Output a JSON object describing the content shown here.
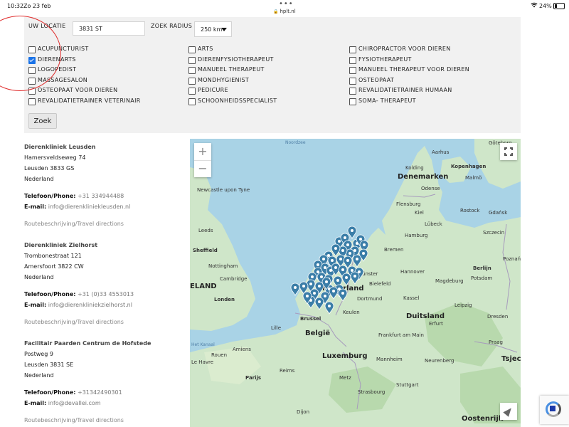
{
  "statusbar": {
    "time": "10:32",
    "date": "Zo 23 feb",
    "url": "hplt.nl",
    "battery": "24%",
    "wifi_icon": "wifi-icon",
    "lock_icon": "lock-icon"
  },
  "filters": {
    "location_label": "UW LOCATIE",
    "location_value": "3831 ST",
    "radius_label": "ZOEK RADIUS",
    "radius_value": "250 km",
    "search_button": "Zoek",
    "categories": [
      {
        "label": "ACUPUNCTURIST",
        "checked": false
      },
      {
        "label": "ARTS",
        "checked": false
      },
      {
        "label": "CHIROPRACTOR VOOR DIEREN",
        "checked": false
      },
      {
        "label": "DIERENARTS",
        "checked": true
      },
      {
        "label": "DIERENFYSIOTHERAPEUT",
        "checked": false
      },
      {
        "label": "FYSIOTHERAPEUT",
        "checked": false
      },
      {
        "label": "LOGOPEDIST",
        "checked": false
      },
      {
        "label": "MANUEEL THERAPEUT",
        "checked": false
      },
      {
        "label": "MANUEEL THERAPEUT VOOR DIEREN",
        "checked": false
      },
      {
        "label": "MASSAGESALON",
        "checked": false
      },
      {
        "label": "MONDHYGIENIST",
        "checked": false
      },
      {
        "label": "OSTEOPAAT",
        "checked": false
      },
      {
        "label": "OSTEOPAAT VOOR DIEREN",
        "checked": false
      },
      {
        "label": "PEDICURE",
        "checked": false
      },
      {
        "label": "REVALIDATIETRAINER HUMAAN",
        "checked": false
      },
      {
        "label": "REVALIDATIETRAINER VETERINAIR",
        "checked": false
      },
      {
        "label": "SCHOONHEIDSSPECIALIST",
        "checked": false
      },
      {
        "label": "SOMA- THERAPEUT",
        "checked": false
      }
    ]
  },
  "results": [
    {
      "name": "Dierenkliniek Leusden",
      "street": "Hamersveldseweg 74",
      "city": "Leusden 3833 GS",
      "country": "Nederland",
      "phone_label": "Telefoon/Phone:",
      "phone": "+31 334944488",
      "email_label": "E-mail:",
      "email": "info@dierenkliniekleusden.nl",
      "route": "Routebeschrijving/Travel directions"
    },
    {
      "name": "Dierenkliniek Zielhorst",
      "street": "Trombonestraat 121",
      "city": "Amersfoort 3822 CW",
      "country": "Nederland",
      "phone_label": "Telefoon/Phone:",
      "phone": "+31 (0)33 4553013",
      "email_label": "E-mail:",
      "email": "info@dierenkliniekzielhorst.nl",
      "route": "Routebeschrijving/Travel directions"
    },
    {
      "name": "Facilitair Paarden Centrum de Hofstede",
      "street": "Postweg 9",
      "city": "Leusden 3831 SE",
      "country": "Nederland",
      "phone_label": "Telefoon/Phone:",
      "phone": "+31342490301",
      "email_label": "E-mail:",
      "email": "info@devallei.com",
      "route": "Routebeschrijving/Travel directions"
    }
  ],
  "map": {
    "zoom_in": "+",
    "zoom_out": "−",
    "labels": {
      "noordzee": "Noordzee",
      "denemarken": "Denemarken",
      "kopenhagen": "Kopenhagen",
      "malmo": "Malmö",
      "flensburg": "Flensburg",
      "kiel": "Kiel",
      "lubeck": "Lübeck",
      "hamburg": "Hamburg",
      "bremen": "Bremen",
      "hannover": "Hannover",
      "berlijn": "Berlijn",
      "bielefeld": "Bielefeld",
      "dortmund": "Dortmund",
      "duitsland": "Duitsland",
      "leipzig": "Leipzig",
      "dresden": "Dresden",
      "erfurt": "Erfurt",
      "keulen": "Keulen",
      "frankfurt": "Frankfurt am Main",
      "nederland": "Nederland",
      "brussel": "Brussel",
      "belgie": "België",
      "luxemburg": "Luxemburg",
      "neurenberg": "Neurenberg",
      "stuttgart": "Stuttgart",
      "parijs": "Parijs",
      "tsjechie": "Tsjech",
      "oostenrijk": "Oostenrijk",
      "londen": "Londen",
      "cambridge": "Cambridge",
      "sheffield": "Sheffield",
      "leeds": "Leeds",
      "newcastle": "Newcastle upon Tyne",
      "nottingham": "Nottingham",
      "engeland": "ELAND",
      "kanaal": "Het Kanaal",
      "magdeburg": "Magdeburg",
      "potsdam": "Potsdam",
      "kassel": "Kassel",
      "munster": "Münster",
      "poznan": "Poznań",
      "mannheim": "Mannheim",
      "strasbourg": "Strasbourg",
      "metz": "Metz",
      "reims": "Reims",
      "praag": "Praag",
      "lille": "Lille",
      "amiens": "Amiens",
      "rouen": "Rouen",
      "dijon": "Dijon",
      "le_havre": "Le Havre",
      "rostock": "Rostock",
      "kolding": "Kolding",
      "odense": "Odense",
      "aarhus": "Aarhus",
      "gdansk": "Gdańsk",
      "szczecin": "Szczecin",
      "goteborg": "Göteborg"
    }
  },
  "colors": {
    "water": "#a9d3e6",
    "land": "#cfe6c9",
    "pin": "#3b7ea8",
    "panel": "#f1f1f1",
    "checkbox_accent": "#1a73e8",
    "annotation_circle": "#e03030"
  }
}
